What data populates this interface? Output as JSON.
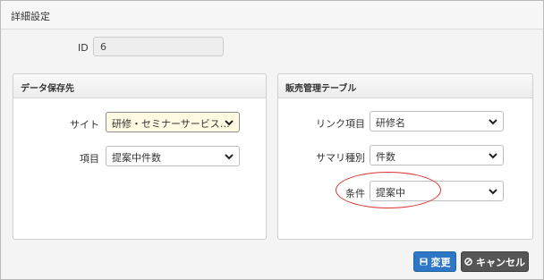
{
  "dialog": {
    "title": "詳細設定"
  },
  "id_field": {
    "label": "ID",
    "value": "6"
  },
  "data_source": {
    "title": "データ保存先",
    "site": {
      "label": "サイト",
      "value": "研修・セミナーサービス…"
    },
    "item": {
      "label": "項目",
      "value": "提案中件数"
    }
  },
  "sales_table": {
    "title": "販売管理テーブル",
    "link_item": {
      "label": "リンク項目",
      "value": "研修名"
    },
    "summary_type": {
      "label": "サマリ種別",
      "value": "件数"
    },
    "condition": {
      "label": "条件",
      "value": "提案中"
    }
  },
  "buttons": {
    "change": "変更",
    "cancel": "キャンセル"
  },
  "colors": {
    "primary": "#2e77c7",
    "default_button": "#555555",
    "highlight_ring": "#d9322a",
    "selected_field_bg": "#fffbe3"
  },
  "icons": [
    "chevron-down-icon",
    "save-icon",
    "cancel-icon"
  ]
}
